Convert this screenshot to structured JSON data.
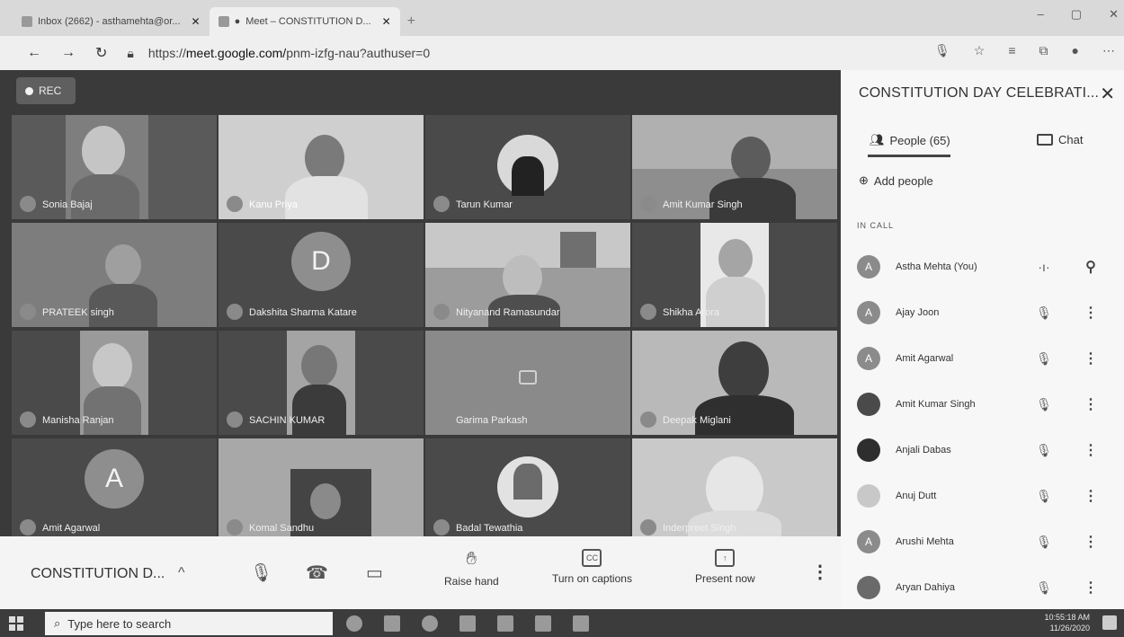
{
  "browser": {
    "tabs": [
      {
        "label": "Inbox (2662) - asthamehta@or...",
        "active": false
      },
      {
        "label": "Meet – CONSTITUTION D...",
        "active": true
      }
    ],
    "url_prefix": "https://",
    "url_domain": "meet.google.com/",
    "url_rest": "pnm-izfg-nau?authuser=0"
  },
  "meet": {
    "rec_label": "REC",
    "tiles": [
      {
        "name": "Sonia Bajaj"
      },
      {
        "name": "Kanu Priya"
      },
      {
        "name": "Tarun Kumar"
      },
      {
        "name": "Amit Kumar Singh"
      },
      {
        "name": "PRATEEK singh"
      },
      {
        "name": "Dakshita Sharma Katare",
        "letter": "D"
      },
      {
        "name": "Nityanand Ramasundar"
      },
      {
        "name": "Shikha Arora"
      },
      {
        "name": "Manisha Ranjan"
      },
      {
        "name": "SACHIN KUMAR"
      },
      {
        "name": "Garima Parkash"
      },
      {
        "name": "Deepak Miglani"
      },
      {
        "name": "Amit Agarwal",
        "letter": "A"
      },
      {
        "name": "Komal Sandhu"
      },
      {
        "name": "Badal Tewathia"
      },
      {
        "name": "Inderpreet Singh"
      }
    ]
  },
  "controls": {
    "meeting_title": "CONSTITUTION D...",
    "raise_hand": "Raise hand",
    "captions": "Turn on captions",
    "present": "Present now"
  },
  "panel": {
    "title": "CONSTITUTION DAY CELEBRATI...",
    "people_tab": "People (65)",
    "chat_tab": "Chat",
    "add_people": "Add people",
    "in_call": "IN CALL",
    "participants": [
      {
        "name": "Astha Mehta (You)",
        "initial": "A"
      },
      {
        "name": "Ajay Joon",
        "initial": "A"
      },
      {
        "name": "Amit Agarwal",
        "initial": "A"
      },
      {
        "name": "Amit Kumar Singh",
        "initial": ""
      },
      {
        "name": "Anjali Dabas",
        "initial": ""
      },
      {
        "name": "Anuj Dutt",
        "initial": ""
      },
      {
        "name": "Arushi Mehta",
        "initial": "A"
      },
      {
        "name": "Aryan Dahiya",
        "initial": ""
      }
    ]
  },
  "taskbar": {
    "search_placeholder": "Type here to search",
    "time": "10:55:18 AM",
    "date": "11/26/2020"
  }
}
